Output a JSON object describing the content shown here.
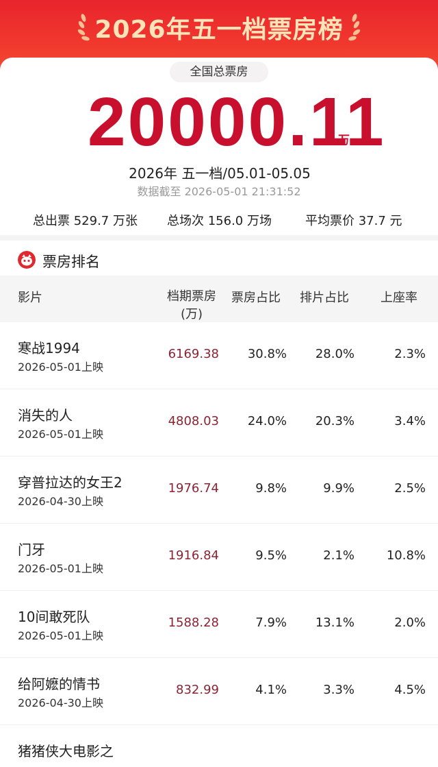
{
  "banner": {
    "title": "2026年五一档票房榜"
  },
  "summary": {
    "label": "全国总票房",
    "total": "20000.11",
    "unit": "万",
    "period": "2026年  五一档/05.01-05.05",
    "updated": "数据截至 2026-05-01 21:31:52"
  },
  "stats": [
    {
      "text": "总出票 529.7 万张"
    },
    {
      "text": "总场次 156.0 万场"
    },
    {
      "text": "平均票价 37.7 元"
    }
  ],
  "section": {
    "title": "票房排名"
  },
  "table": {
    "headers": {
      "film": "影片",
      "box_line1": "档期票房",
      "box_line2": "(万)",
      "share": "票房占比",
      "schedule": "排片占比",
      "occupancy": "上座率"
    },
    "rows": [
      {
        "name": "寒战1994",
        "date": "2026-05-01上映",
        "box": "6169.38",
        "share": "30.8%",
        "schedule": "28.0%",
        "occupancy": "2.3%"
      },
      {
        "name": "消失的人",
        "date": "2026-05-01上映",
        "box": "4808.03",
        "share": "24.0%",
        "schedule": "20.3%",
        "occupancy": "3.4%"
      },
      {
        "name": "穿普拉达的女王2",
        "date": "2026-04-30上映",
        "box": "1976.74",
        "share": "9.8%",
        "schedule": "9.9%",
        "occupancy": "2.5%"
      },
      {
        "name": "门牙",
        "date": "2026-05-01上映",
        "box": "1916.84",
        "share": "9.5%",
        "schedule": "2.1%",
        "occupancy": "10.8%"
      },
      {
        "name": "10间敢死队",
        "date": "2026-05-01上映",
        "box": "1588.28",
        "share": "7.9%",
        "schedule": "13.1%",
        "occupancy": "2.0%"
      },
      {
        "name": "给阿嬷的情书",
        "date": "2026-04-30上映",
        "box": "832.99",
        "share": "4.1%",
        "schedule": "3.3%",
        "occupancy": "4.5%"
      },
      {
        "name": "猪猪侠大电影之",
        "date": "",
        "box": "",
        "share": "",
        "schedule": "",
        "occupancy": ""
      }
    ]
  },
  "colors": {
    "brand_red": "#e8242c",
    "number_red": "#c8102e",
    "box_value": "#8b2333",
    "banner_text": "#fde3b8"
  }
}
